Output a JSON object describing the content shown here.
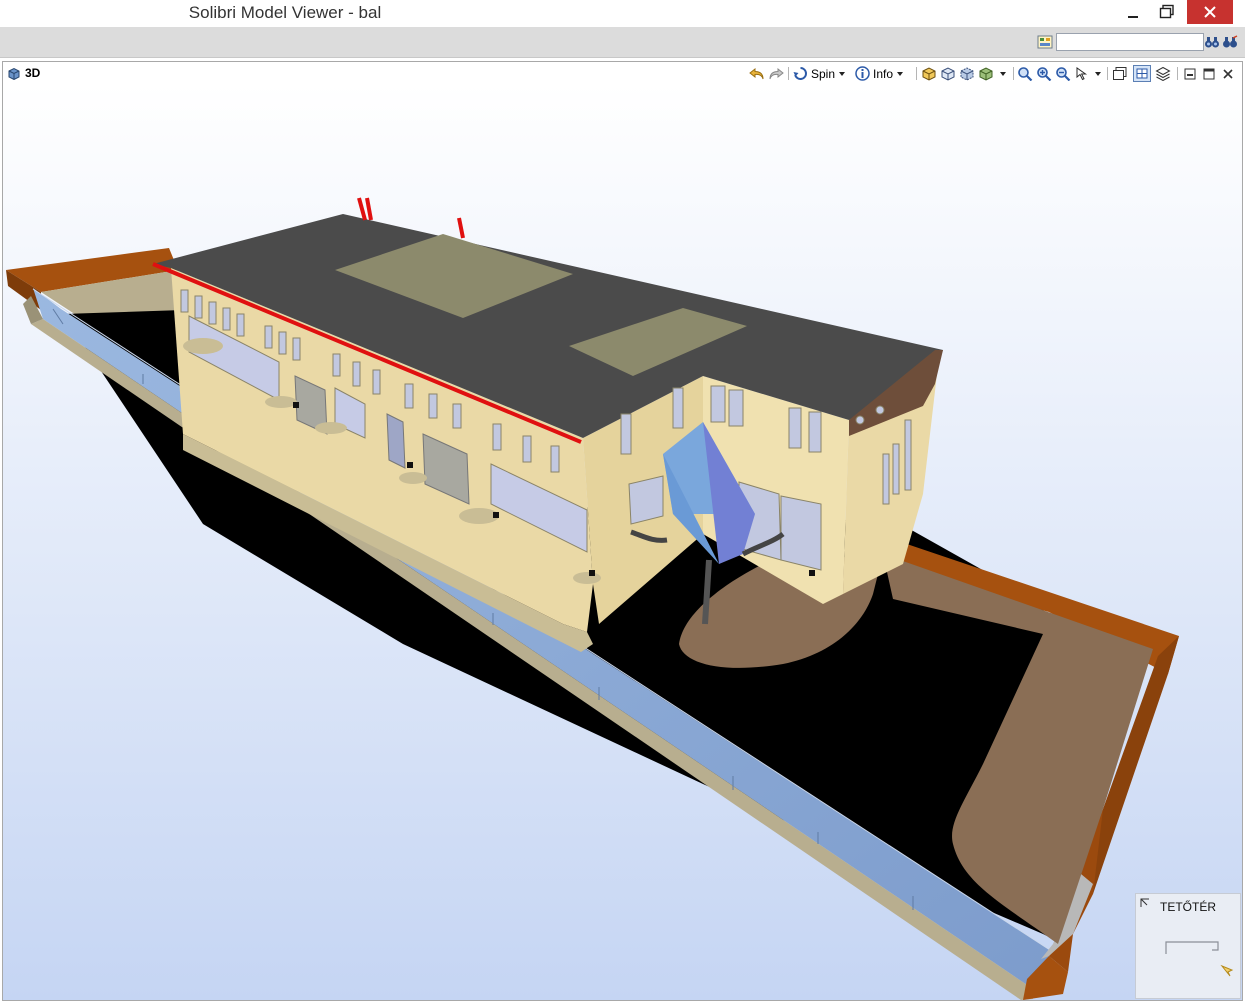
{
  "window": {
    "title": "Solibri Model Viewer - bal",
    "controls": {
      "minimize": "minimize",
      "maximize": "maximize",
      "close": "close"
    }
  },
  "topbar": {
    "search_value": "",
    "search_placeholder": ""
  },
  "view": {
    "tab_title": "3D",
    "toolbar": {
      "spin_label": "Spin",
      "info_label": "Info"
    }
  },
  "navigator": {
    "floor_label": "TETŐTÉR"
  },
  "colors": {
    "close_button": "#c7322f",
    "background_top": "#ffffff",
    "background_bottom": "#c7d6f2",
    "roof": "#4b4b4b",
    "facade": "#ead9a6",
    "ground": "#000000",
    "paving": "#8a6e55",
    "wall_brick": "#a6510f",
    "glass": "#86a9d8",
    "railing_red": "#e01010"
  },
  "icons": [
    "minimize-icon",
    "maximize-icon",
    "close-icon",
    "browse-icon",
    "search-icon",
    "binoculars-icon",
    "undo-icon",
    "redo-icon",
    "spin-icon",
    "info-icon",
    "cube-icon",
    "zoom-icon",
    "pan-icon",
    "layout-icon",
    "navigator-icon"
  ]
}
